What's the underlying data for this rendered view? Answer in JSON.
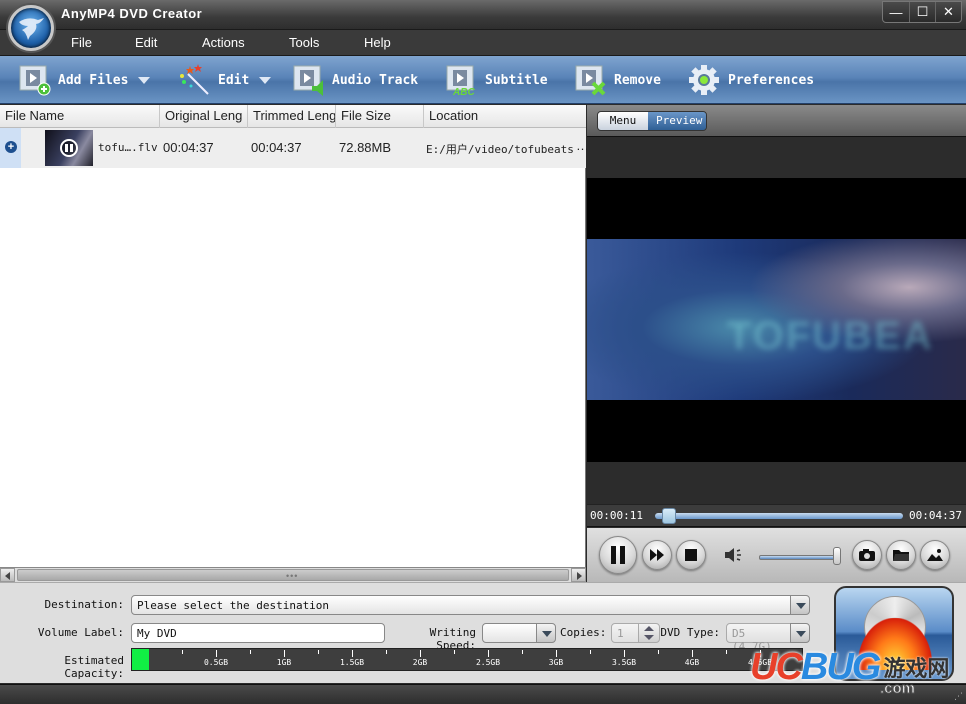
{
  "window": {
    "title": "AnyMP4 DVD Creator",
    "controls": {
      "minimize": "—",
      "maximize": "☐",
      "close": "✕"
    }
  },
  "menu": [
    "File",
    "Edit",
    "Actions",
    "Tools",
    "Help"
  ],
  "toolbar": {
    "add_files": "Add Files",
    "edit": "Edit",
    "audio_track": "Audio Track",
    "subtitle": "Subtitle",
    "remove": "Remove",
    "preferences": "Preferences"
  },
  "file_list": {
    "columns": [
      "File Name",
      "Original Leng",
      "Trimmed Leng",
      "File Size",
      "Location"
    ],
    "rows": [
      {
        "expand_icon": "+",
        "name": "tofu….flv",
        "original_length": "00:04:37",
        "trimmed_length": "00:04:37",
        "file_size": "72.88MB",
        "location": "E:/用户/video/tofubeats",
        "more": "…"
      }
    ],
    "scroll_grip": "•••"
  },
  "preview": {
    "tabs": [
      "Menu",
      "Preview"
    ],
    "active_tab": "Preview",
    "video_overlay_text": "TOFUBEA",
    "time_current": "00:00:11",
    "time_total": "00:04:37",
    "seek_progress": 0.04,
    "volume_level": 1.0
  },
  "settings": {
    "destination_label": "Destination:",
    "destination_value": "Please select the destination",
    "volume_label_label": "Volume Label:",
    "volume_label_value": "My DVD",
    "writing_speed_label": "Writing Speed:",
    "writing_speed_value": "",
    "copies_label": "Copies:",
    "copies_value": "1",
    "dvd_type_label": "DVD Type:",
    "dvd_type_value": "D5 (4.7G)",
    "capacity_label": "Estimated Capacity:",
    "capacity_used_fraction": 0.025,
    "capacity_scale": [
      "0.5GB",
      "1GB",
      "1.5GB",
      "2GB",
      "2.5GB",
      "3GB",
      "3.5GB",
      "4GB",
      "4.5GB"
    ],
    "capacity_fill_color": "#11ee44"
  },
  "watermark": {
    "part1": "UC",
    "part2": "BUG",
    "cn": "游戏网",
    "com": ".com"
  },
  "colors": {
    "toolbar_blue": "#5a84b8",
    "accent_green": "#11ee44"
  }
}
